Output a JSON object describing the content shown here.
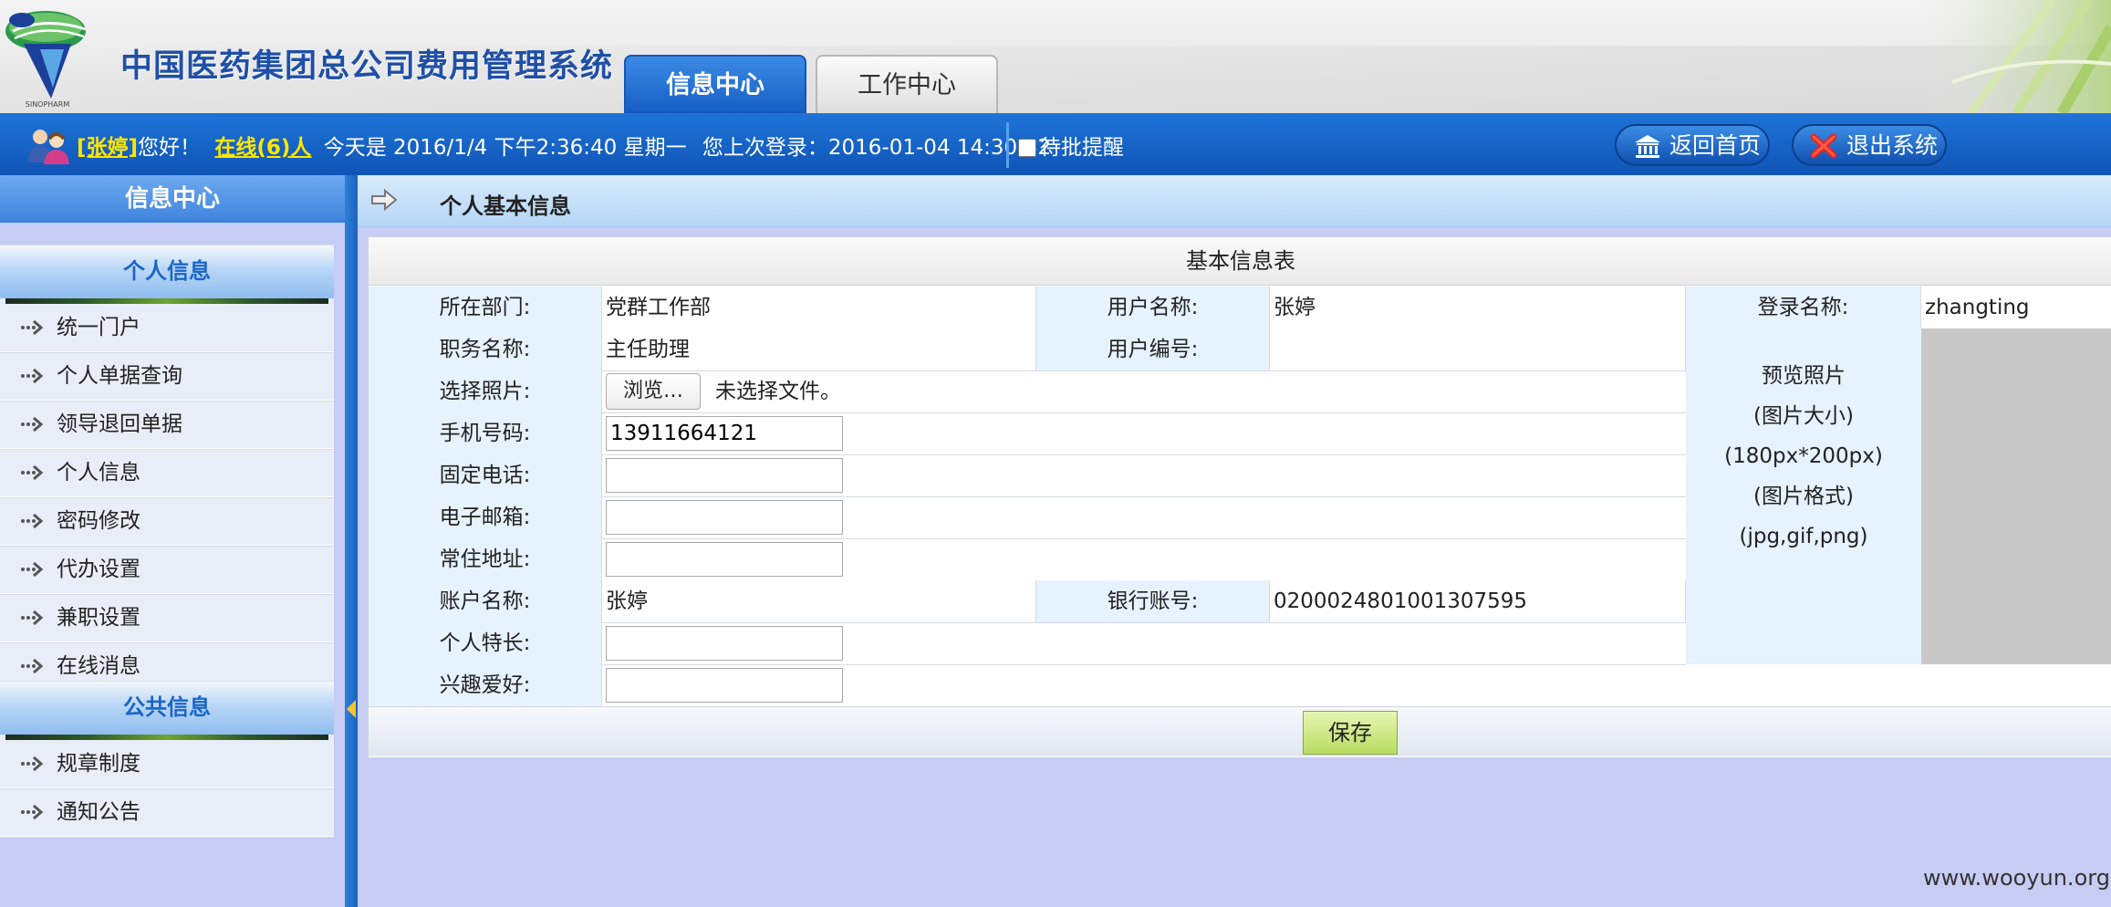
{
  "app": {
    "title": "中国医药集团总公司费用管理系统",
    "logo_text": "SINOPHARM"
  },
  "tabs": [
    {
      "label": "信息中心",
      "active": true
    },
    {
      "label": "工作中心",
      "active": false
    }
  ],
  "userbar": {
    "username": "[张婷]",
    "greeting": "您好！",
    "online": "在线(6)人",
    "today_text": "今天是 2016/1/4 下午2:36:40 星期一",
    "last_login": "您上次登录：2016-01-04 14:30:42",
    "remind_label": "待批提醒",
    "remind_checked": false,
    "home_label": "返回首页",
    "exit_label": "退出系统"
  },
  "sidebar": {
    "title": "信息中心",
    "groups": [
      {
        "title": "个人信息",
        "items": [
          "统一门户",
          "个人单据查询",
          "领导退回单据",
          "个人信息",
          "密码修改",
          "代办设置",
          "兼职设置",
          "在线消息"
        ]
      },
      {
        "title": "公共信息",
        "items": [
          "规章制度",
          "通知公告"
        ]
      }
    ]
  },
  "breadcrumb": "个人基本信息",
  "form": {
    "title": "基本信息表",
    "dept_label": "所在部门:",
    "dept_value": "党群工作部",
    "username_label": "用户名称:",
    "username_value": "张婷",
    "login_label": "登录名称:",
    "login_value": "zhangting",
    "position_label": "职务名称:",
    "position_value": "主任助理",
    "userno_label": "用户编号:",
    "userno_value": "",
    "photo_label": "选择照片:",
    "browse_label": "浏览…",
    "nofile_text": "未选择文件。",
    "mobile_label": "手机号码:",
    "mobile_value": "13911664121",
    "phone_label": "固定电话:",
    "phone_value": "",
    "email_label": "电子邮箱:",
    "email_value": "",
    "address_label": "常住地址:",
    "address_value": "",
    "account_label": "账户名称:",
    "account_value": "张婷",
    "bank_label": "银行账号:",
    "bank_value": "0200024801001307595",
    "skill_label": "个人特长:",
    "skill_value": "",
    "hobby_label": "兴趣爱好:",
    "hobby_value": "",
    "preview_lines": [
      "预览照片",
      "(图片大小)",
      "(180px*200px)",
      "(图片格式)",
      "(jpg,gif,png)"
    ],
    "save_label": "保存"
  },
  "watermark": "www.wooyun.org"
}
